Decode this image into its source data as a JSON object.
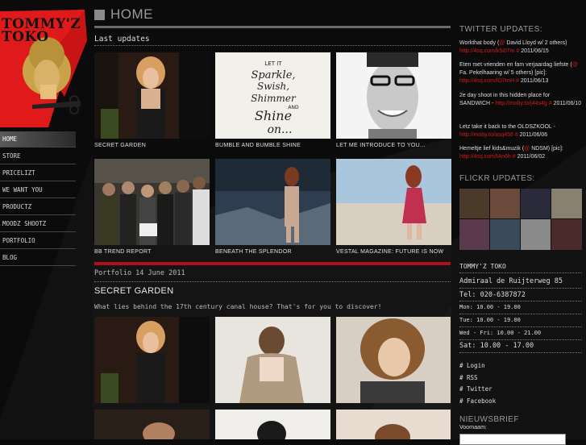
{
  "logo": {
    "line1": "TOMMY'Z",
    "line2": "TOKO"
  },
  "nav": {
    "items": [
      {
        "label": "HOME"
      },
      {
        "label": "STORE"
      },
      {
        "label": "PRICELIZT"
      },
      {
        "label": "WE WANT YOU"
      },
      {
        "label": "PRODUCTZ"
      },
      {
        "label": "MOODZ SHOOTZ"
      },
      {
        "label": "PORTFOLIO"
      },
      {
        "label": "BLOG"
      }
    ]
  },
  "main": {
    "title": "HOME",
    "section_label": "Last updates",
    "updates": [
      {
        "caption": "SECRET GARDEN"
      },
      {
        "caption": "BUMBLE AND BUMBLE SHINE"
      },
      {
        "caption": "LET ME INTRODUCE TO YOU..."
      },
      {
        "caption": "BB TREND REPORT"
      },
      {
        "caption": "BENEATH THE SPLENDOR"
      },
      {
        "caption": "VESTAL MAGAZINE: FUTURE IS NOW"
      }
    ],
    "shine_art": {
      "line1": "LET IT",
      "line2": "Sparkle,",
      "line3": "Swish,",
      "line4": "Shimmer",
      "line5": "AND",
      "line6": "Shine",
      "line7": "on..."
    },
    "post": {
      "meta": "Portfolio 14 June 2011",
      "title": "SECRET GARDEN",
      "desc": "What lies behind the 17th century canal house? That's for you to discover!"
    }
  },
  "sidebar": {
    "twitter_title": "TWITTER UPDATES:",
    "tweets": [
      {
        "text": "Workthat body (",
        "mention": "@",
        "text2": " David Lloyd w/ 2 others)",
        "link": "http://4sq.com/k5i07m #",
        "date": " 2011/06/15"
      },
      {
        "text": "Eten met vrienden en fam verjaardag liefste (",
        "mention": "@",
        "text2": " Fa. Pekelhaaring w/ 5 others) [pic]:",
        "link": "http://4sq.com/lO7rnH #",
        "date": " 2011/06/13"
      },
      {
        "text": "2e day shoot in this hidden place for SANDWICH - ",
        "mention": "",
        "text2": "",
        "link": "http://moby.to/j44s4g #",
        "date": " 2011/06/10"
      },
      {
        "text": "Letz take it back to the OLDSZKOOL - ",
        "mention": "",
        "text2": "",
        "link": "http://moby.to/asq456 #",
        "date": " 2011/06/06"
      },
      {
        "text": "Hemeltje lief kids&muzik (",
        "mention": "@",
        "text2": " NDSM) [pic]:",
        "link": "http://4sq.com/lAn6h #",
        "date": " 2011/06/02"
      }
    ],
    "flickr_title": "FLICKR UPDATES:",
    "shop": {
      "name": "TOMMY'Z TOKO",
      "address": "Admiraal de Ruijterweg 85",
      "tel": "Tel: 020-6387872",
      "hours": [
        {
          "label": "Mon: 10.00 - 19.00"
        },
        {
          "label": "Tue: 10.00 - 19.00"
        },
        {
          "label": "Wed - Fri: 10.00 - 21.00"
        },
        {
          "label": "Sat: 10.00 - 17.00"
        }
      ]
    },
    "links": [
      {
        "label": "# Login"
      },
      {
        "label": "# RSS"
      },
      {
        "label": "# Twitter"
      },
      {
        "label": "# Facebook"
      }
    ],
    "newsletter_title": "NIEUWSBRIEF",
    "newsletter_label": "Voornaam:"
  },
  "colors": {
    "accent_red": "#b0101a",
    "link_red": "#d11a1a",
    "background": "#0b0b0b"
  }
}
